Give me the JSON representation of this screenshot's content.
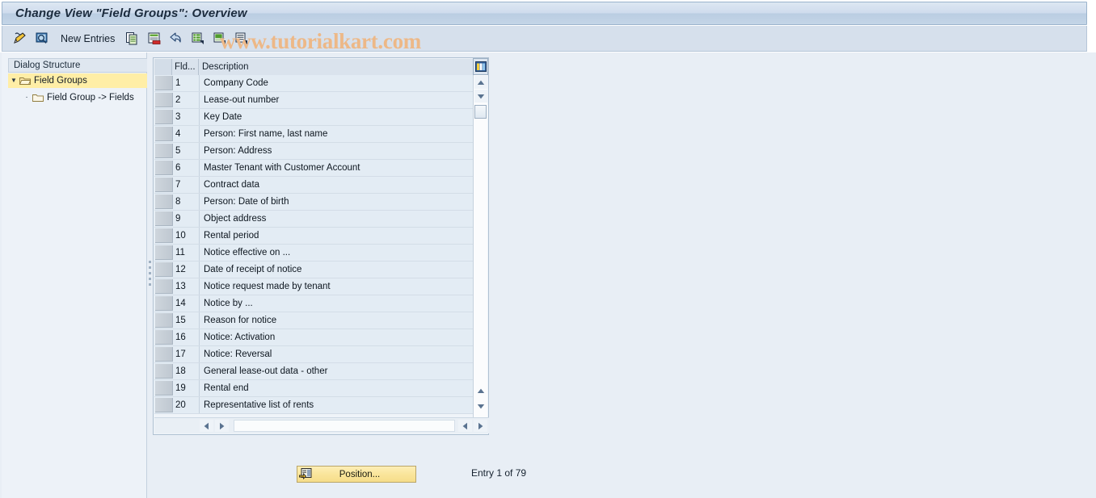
{
  "window": {
    "title": "Change View \"Field Groups\": Overview"
  },
  "toolbar": {
    "buttons": [
      {
        "name": "display-change-icon",
        "tooltip": "Display/Change"
      },
      {
        "name": "check-entries-icon",
        "tooltip": "Check entries"
      }
    ],
    "new_entries_label": "New Entries",
    "action_buttons": [
      {
        "name": "copy-as-icon",
        "tooltip": "Copy As..."
      },
      {
        "name": "delete-icon",
        "tooltip": "Delete"
      },
      {
        "name": "undo-icon",
        "tooltip": "Undo Change"
      },
      {
        "name": "select-all-icon",
        "tooltip": "Select All"
      },
      {
        "name": "select-block-icon",
        "tooltip": "Select Block"
      },
      {
        "name": "deselect-all-icon",
        "tooltip": "Deselect All"
      }
    ]
  },
  "watermark": {
    "text": "www.tutorialkart.com"
  },
  "sidebar": {
    "header": "Dialog Structure",
    "items": [
      {
        "label": "Field Groups",
        "selected": true,
        "expanded": true
      },
      {
        "label": "Field Group -> Fields",
        "selected": false,
        "expanded": false
      }
    ]
  },
  "table": {
    "columns": [
      {
        "key": "fld",
        "label": "Fld..."
      },
      {
        "key": "description",
        "label": "Description"
      }
    ],
    "rows": [
      {
        "fld": "1",
        "description": "Company Code"
      },
      {
        "fld": "2",
        "description": "Lease-out number"
      },
      {
        "fld": "3",
        "description": "Key Date"
      },
      {
        "fld": "4",
        "description": "Person: First name, last name"
      },
      {
        "fld": "5",
        "description": "Person: Address"
      },
      {
        "fld": "6",
        "description": "Master Tenant with Customer Account"
      },
      {
        "fld": "7",
        "description": "Contract data"
      },
      {
        "fld": "8",
        "description": "Person: Date of birth"
      },
      {
        "fld": "9",
        "description": "Object address"
      },
      {
        "fld": "10",
        "description": "Rental period"
      },
      {
        "fld": "11",
        "description": "Notice effective on ..."
      },
      {
        "fld": "12",
        "description": "Date of receipt of notice"
      },
      {
        "fld": "13",
        "description": "Notice request made by tenant"
      },
      {
        "fld": "14",
        "description": "Notice by ..."
      },
      {
        "fld": "15",
        "description": "Reason for notice"
      },
      {
        "fld": "16",
        "description": "Notice: Activation"
      },
      {
        "fld": "17",
        "description": "Notice: Reversal"
      },
      {
        "fld": "18",
        "description": "General lease-out data - other"
      },
      {
        "fld": "19",
        "description": "Rental end"
      },
      {
        "fld": "20",
        "description": "Representative list of rents"
      }
    ]
  },
  "footer": {
    "position_button_label": "Position...",
    "entry_status": "Entry 1 of 79"
  },
  "colors": {
    "title_bar": "#c4d5e7",
    "toolbar": "#d6e0ec",
    "selection_highlight": "#ffeea6",
    "row_background": "#e3ecf4",
    "button_yellow": "#f6dd8a",
    "watermark": "#edb887"
  }
}
